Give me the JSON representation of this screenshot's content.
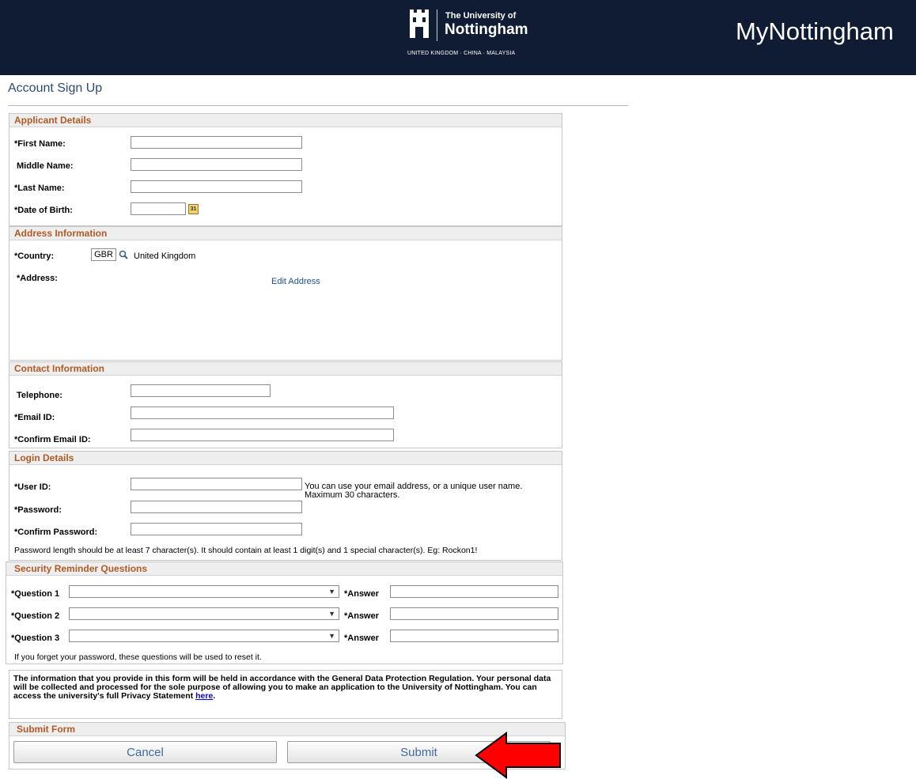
{
  "header": {
    "logo_top": "The University of",
    "logo_name": "Nottingham",
    "logo_sub": "UNITED KINGDOM · CHINA · MALAYSIA",
    "app_title": "MyNottingham"
  },
  "page": {
    "title": "Account Sign Up"
  },
  "applicant": {
    "heading": "Applicant Details",
    "first_name": "*First Name:",
    "middle_name": "Middle Name:",
    "last_name": "*Last Name:",
    "dob": "*Date of Birth:",
    "calendar_icon_text": "31"
  },
  "address": {
    "heading": "Address Information",
    "country_label": "*Country:",
    "country_code": "GBR",
    "country_name": "United Kingdom",
    "address_label": "*Address:",
    "edit_address": "Edit Address"
  },
  "contact": {
    "heading": "Contact Information",
    "telephone": "Telephone:",
    "email": "*Email ID:",
    "confirm_email": "*Confirm Email ID:"
  },
  "login": {
    "heading": "Login Details",
    "user_id": "*User ID:",
    "user_id_help_1": "You can use your email address, or a unique user name.",
    "user_id_help_2": "Maximum 30 characters.",
    "password": "*Password:",
    "confirm_password": "*Confirm Password:",
    "password_rule": "Password length should be at least 7 character(s). It should contain at least 1 digit(s) and 1 special character(s). Eg: Rockon1!"
  },
  "security": {
    "heading": "Security Reminder Questions",
    "questions": [
      {
        "label": "*Question 1",
        "answer_label": "*Answer"
      },
      {
        "label": "*Question 2",
        "answer_label": "*Answer"
      },
      {
        "label": "*Question 3",
        "answer_label": "*Answer"
      }
    ],
    "note": "If you forget your password, these questions will be used to reset it."
  },
  "notice": {
    "text": "The information that you provide in this form will be held in accordance with the General Data Protection Regulation. Your personal data will be collected and processed for the sole purpose of allowing you to make an application to the University of Nottingham. You can access the university's full Privacy Statement ",
    "link": "here",
    "end": "."
  },
  "submit_form": {
    "heading": "Submit Form",
    "cancel": "Cancel",
    "submit": "Submit"
  },
  "colors": {
    "header_bg": "#0f1c33",
    "section_heading": "#b05a25",
    "link": "#1d4f8f",
    "annotation_arrow": "#ff0000"
  }
}
